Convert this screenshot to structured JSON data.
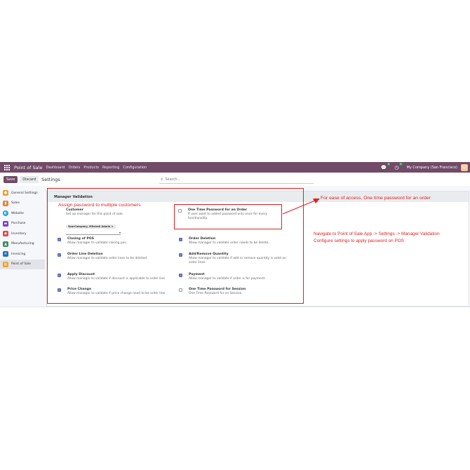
{
  "navbar": {
    "brand": "Point of Sale",
    "menu": [
      "Dashboard",
      "Orders",
      "Products",
      "Reporting",
      "Configuration"
    ],
    "messages_badge": "5",
    "activity_badge": "5",
    "company": "My Company (San Francisco)"
  },
  "control": {
    "save_label": "Save",
    "discard_label": "Discard",
    "title": "Settings",
    "search_placeholder": "Search..."
  },
  "sidebar": {
    "items": [
      {
        "label": "General Settings",
        "color": "#f0a020"
      },
      {
        "label": "Sales",
        "color": "#e8843c"
      },
      {
        "label": "Website",
        "color": "#2a9fd6"
      },
      {
        "label": "Purchase",
        "color": "#7d3ce0"
      },
      {
        "label": "Inventory",
        "color": "#e04a4a"
      },
      {
        "label": "Manufacturing",
        "color": "#3a8f5c"
      },
      {
        "label": "Invoicing",
        "color": "#1e73be"
      },
      {
        "label": "Point of Sale",
        "color": "#f0a020"
      }
    ]
  },
  "section": {
    "title": "Manager Validation",
    "customer": {
      "title": "Customer",
      "desc": "Set up manager for this point of sale.",
      "tag": "YourCompany, Mitchell Admin ×"
    },
    "otp_order": {
      "title": "One Time Password for an Order",
      "desc": "If user want to added password only once for every functionality."
    },
    "closing_pos": {
      "title": "Closing of POS",
      "desc": "Allow manager to validate closing pos."
    },
    "order_deletion": {
      "title": "Order Deletion",
      "desc": "Allow manager to validate order needs to be delete."
    },
    "order_line_deletion": {
      "title": "Order Line Deletion",
      "desc": "Allow manager to validate order lines to be deleted."
    },
    "add_remove_qty": {
      "title": "Add/Remove Quantity",
      "desc": "Allow manager to validate if add or remove quantity is valid on order lines."
    },
    "apply_discount": {
      "title": "Apply Discount",
      "desc": "Allow manager to validate if discount is applicable to order line."
    },
    "payment": {
      "title": "Payment",
      "desc": "Allow manager to validate if order is for payment."
    },
    "price_change": {
      "title": "Price Change",
      "desc": "Allow manager to validate if price change need to be order line."
    },
    "otp_session": {
      "title": "One Time Password for Session",
      "desc": "One Time Password for an Session."
    }
  },
  "annotations": {
    "assign": "Assign password to multiple customers",
    "ease": "For ease of access, One time password for an order",
    "navigate_line1": "Navigate to Point of Sale App -> Settings -> Manager Validation",
    "navigate_line2": "Configure settings to apply password on POS"
  },
  "colors": {
    "brand": "#714b67",
    "annotation": "#e02020",
    "checkbox": "#5c6bb5"
  }
}
